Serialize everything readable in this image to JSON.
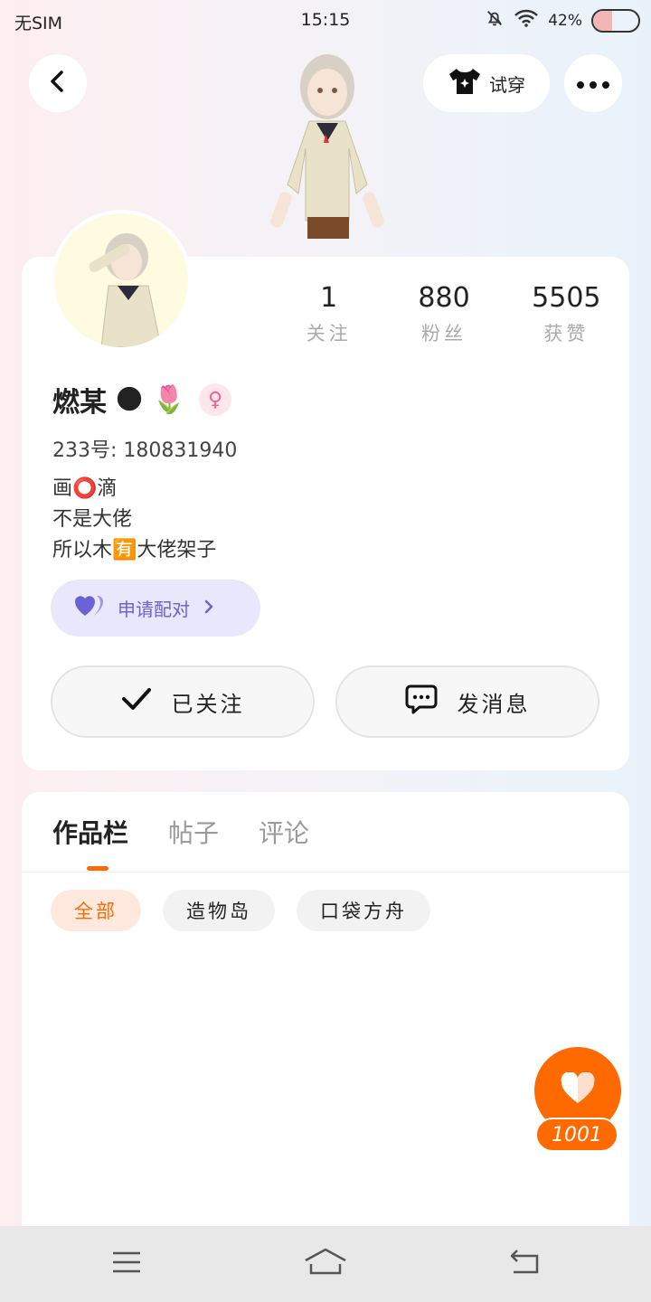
{
  "status_bar": {
    "carrier": "无SIM",
    "time": "15:15",
    "battery_percent_text": "42%",
    "battery_level": 0.42
  },
  "top_bar": {
    "back_icon": "chevron-left-icon",
    "try_on_label": "试穿",
    "more_icon": "more-dots-icon"
  },
  "profile": {
    "stats": [
      {
        "value": "1",
        "label": "关注"
      },
      {
        "value": "880",
        "label": "粉丝"
      },
      {
        "value": "5505",
        "label": "获赞"
      }
    ],
    "nickname": "燃某",
    "nickname_emojis": [
      "🌑",
      "🌷"
    ],
    "gender_symbol": "♀",
    "uid": "233号: 180831940",
    "bio_lines": [
      "画⭕滴",
      "不是大佬",
      "所以木🈶大佬架子"
    ],
    "pair_button_label": "申请配对",
    "follow_button_label": "已关注",
    "message_button_label": "发消息"
  },
  "works": {
    "tabs": [
      "作品栏",
      "帖子",
      "评论"
    ],
    "active_tab": "作品栏",
    "filters": [
      "全部",
      "造物岛",
      "口袋方舟"
    ],
    "active_filter": "全部"
  },
  "like_button": {
    "count": "1001"
  },
  "colors": {
    "accent": "#ff6a00",
    "pair_purple": "#6b62d8",
    "pair_bg": "#e8e7fb"
  }
}
